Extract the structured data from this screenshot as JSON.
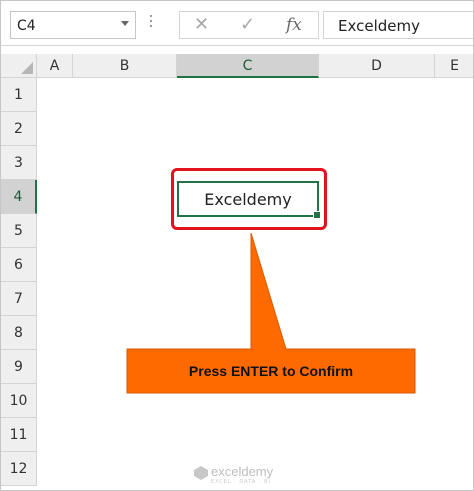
{
  "name_box": {
    "value": "C4"
  },
  "formula_bar": {
    "cancel_icon": "✕",
    "enter_icon": "✓",
    "fx_label": "fx",
    "content": "Exceldemy"
  },
  "columns": [
    {
      "label": "A",
      "selected": false
    },
    {
      "label": "B",
      "selected": false
    },
    {
      "label": "C",
      "selected": true
    },
    {
      "label": "D",
      "selected": false
    },
    {
      "label": "E",
      "selected": false
    }
  ],
  "rows": [
    "1",
    "2",
    "3",
    "4",
    "5",
    "6",
    "7",
    "8",
    "9",
    "10",
    "11",
    "12"
  ],
  "selected_row": "4",
  "active_cell": {
    "ref": "C4",
    "value": "Exceldemy"
  },
  "callout": {
    "text": "Press ENTER to Confirm",
    "color": "#ff6a00"
  },
  "highlight_color": "#e0141e",
  "selection_color": "#217346",
  "watermark": {
    "brand": "exceldemy",
    "tagline": "EXCEL · DATA · BI"
  }
}
